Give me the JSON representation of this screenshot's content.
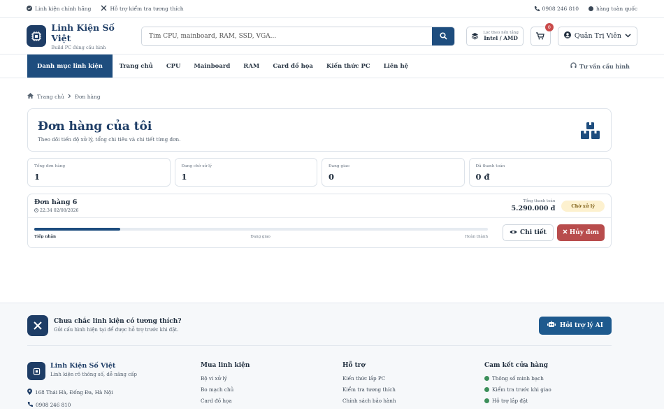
{
  "topbar": {
    "left": [
      "Linh kiện chính hãng",
      "Hỗ trợ kiểm tra tương thích"
    ],
    "phone": "0908 246 810",
    "right_tail": "hàng toàn quốc"
  },
  "header": {
    "brand": "Linh Kiện Số Việt",
    "tagline": "Build PC đúng cấu hình",
    "search_placeholder": "Tìm CPU, mainboard, RAM, SSD, VGA...",
    "filter_label": "Lọc theo nền tảng",
    "filter_value": "Intel / AMD",
    "cart_count": "0",
    "user": "Quản Trị Viên"
  },
  "nav": {
    "category": "Danh mục linh kiện",
    "items": [
      "Trang chủ",
      "CPU",
      "Mainboard",
      "RAM",
      "Card đồ họa",
      "Kiến thức PC",
      "Liên hệ"
    ],
    "consult": "Tư vấn cấu hình"
  },
  "breadcrumb": {
    "home": "Trang chủ",
    "current": "Đơn hàng"
  },
  "page": {
    "title": "Đơn hàng của tôi",
    "subtitle": "Theo dõi tiến độ xử lý, tổng chi tiêu và chi tiết từng đơn."
  },
  "stats": [
    {
      "label": "Tổng đơn hàng",
      "value": "1"
    },
    {
      "label": "Đang chờ xử lý",
      "value": "1"
    },
    {
      "label": "Đang giao",
      "value": "0"
    },
    {
      "label": "Đã thanh toán",
      "value": "0 đ"
    }
  ],
  "order": {
    "title": "Đơn hàng 6",
    "datetime": "22:34 02/08/2026",
    "total_label": "Tổng thanh toán",
    "total": "5.290.000 đ",
    "status": "Chờ xử lý",
    "progress": 0.19,
    "steps": [
      "Tiếp nhận",
      "Đang giao",
      "Hoàn thành"
    ],
    "detail_button": "Chi tiết",
    "cancel_button": "Hủy đơn"
  },
  "footer": {
    "help_title": "Chưa chắc linh kiện có tương thích?",
    "help_sub": "Gửi cấu hình hiện tại để được hỗ trợ trước khi đặt.",
    "ai_button": "Hỏi trợ lý AI",
    "brand": "Linh Kiện Số Việt",
    "brand_sub": "Linh kiện rõ thông số, dễ nâng cấp",
    "address": "168 Thái Hà, Đống Đa, Hà Nội",
    "phone": "0908 246 810",
    "col_buy_title": "Mua linh kiện",
    "col_buy": [
      "Bộ vi xử lý",
      "Bo mạch chủ",
      "Card đồ họa"
    ],
    "col_support_title": "Hỗ trợ",
    "col_support": [
      "Kiến thức lắp PC",
      "Kiểm tra tương thích",
      "Chính sách bảo hành"
    ],
    "col_commit_title": "Cam kết cửa hàng",
    "col_commit": [
      "Thông số minh bạch",
      "Kiểm tra trước khi giao",
      "Hỗ trợ lắp đặt"
    ]
  },
  "colors": {
    "primary": "#1e4d7e",
    "brand": "#1e3d66",
    "danger": "#b84c4c",
    "pending_bg": "#fdf1cf"
  }
}
